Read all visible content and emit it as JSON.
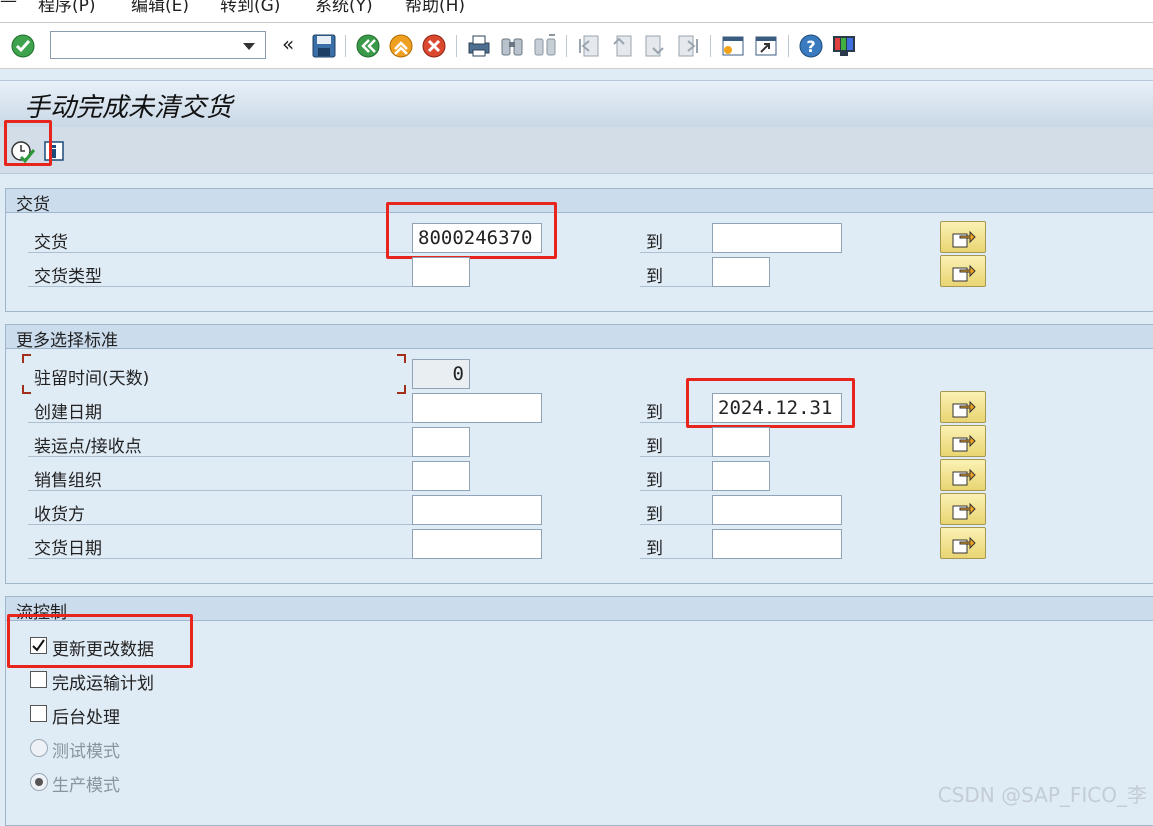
{
  "menu": {
    "items": [
      "程序(P)",
      "编辑(E)",
      "转到(G)",
      "系统(Y)",
      "帮助(H)"
    ]
  },
  "toolbar": {
    "command_value": "",
    "icons": [
      "enter-icon",
      "command-field",
      "back-arrows-icon",
      "save-icon",
      "back-icon",
      "exit-icon",
      "cancel-icon",
      "print-icon",
      "find-icon",
      "find-next-icon",
      "first-page-icon",
      "previous-page-icon",
      "next-page-icon",
      "last-page-icon",
      "create-session-icon",
      "shortcut-icon",
      "help-icon",
      "customize-layout-icon"
    ]
  },
  "title": "手动完成未清交货",
  "app_toolbar": {
    "icons": [
      "execute-icon",
      "info-icon"
    ]
  },
  "sections": {
    "delivery": {
      "header": "交货",
      "rows": [
        {
          "label": "交货",
          "from": "8000246370",
          "to_label": "到",
          "to": ""
        },
        {
          "label": "交货类型",
          "from": "",
          "to_label": "到",
          "to": ""
        }
      ]
    },
    "more": {
      "header": "更多选择标准",
      "dwell": {
        "label": "驻留时间(天数)",
        "value": "0"
      },
      "rows": [
        {
          "label": "创建日期",
          "from": "",
          "to_label": "到",
          "to": "2024.12.31"
        },
        {
          "label": "装运点/接收点",
          "from": "",
          "to_label": "到",
          "to": ""
        },
        {
          "label": "销售组织",
          "from": "",
          "to_label": "到",
          "to": ""
        },
        {
          "label": "收货方",
          "from": "",
          "to_label": "到",
          "to": ""
        },
        {
          "label": "交货日期",
          "from": "",
          "to_label": "到",
          "to": ""
        }
      ]
    },
    "flow": {
      "header": "流控制",
      "options": [
        {
          "label": "更新更改数据",
          "checked": true
        },
        {
          "label": "完成运输计划",
          "checked": false
        },
        {
          "label": "后台处理",
          "checked": false
        },
        {
          "label": "测试模式",
          "selected": false
        },
        {
          "label": "生产模式",
          "selected": true
        }
      ]
    }
  },
  "watermark": "CSDN @SAP_FICO_李"
}
